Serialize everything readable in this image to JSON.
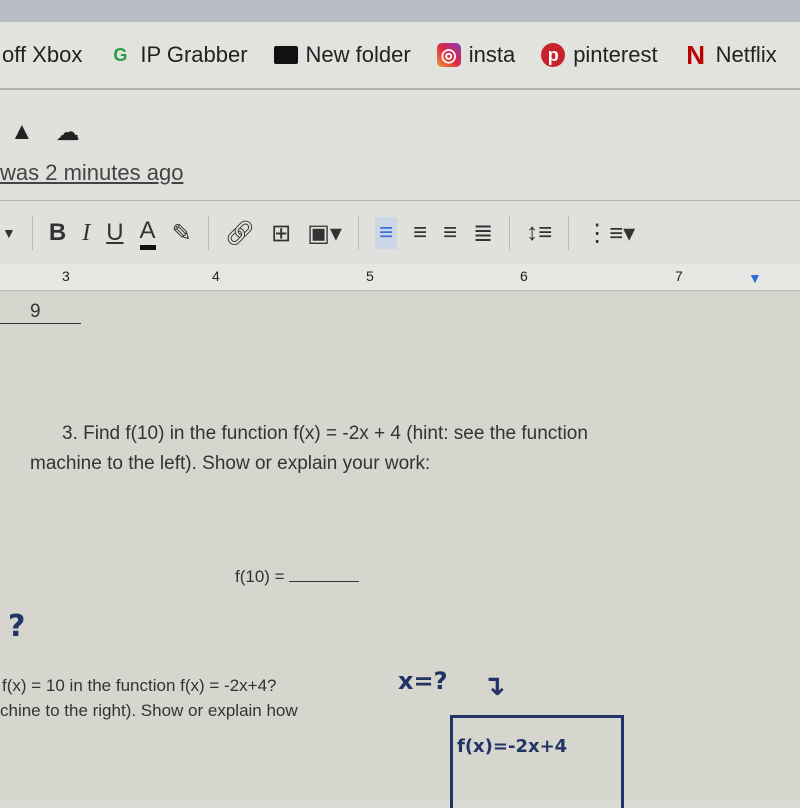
{
  "bookmarks": [
    {
      "label": "off Xbox",
      "icon": "none"
    },
    {
      "label": "IP Grabber",
      "icon": "g-logo-icon"
    },
    {
      "label": "New folder",
      "icon": "folder-icon"
    },
    {
      "label": "insta",
      "icon": "instagram-icon"
    },
    {
      "label": "pinterest",
      "icon": "pinterest-icon"
    },
    {
      "label": "Netflix",
      "icon": "netflix-icon"
    }
  ],
  "header": {
    "saved_status": "was 2 minutes ago"
  },
  "toolbar": {
    "bold": "B",
    "italic": "I",
    "underline": "U",
    "text_color": "A"
  },
  "ruler": [
    "3",
    "4",
    "5",
    "6",
    "7"
  ],
  "doc": {
    "prev_answer": "9",
    "q3_line1": "3.  Find f(10) in the function f(x) = -2x + 4 (hint: see the function",
    "q3_line2": "machine to the left). Show or explain your work:",
    "f10_label": "f(10) = ",
    "q4_heading": "?",
    "q4_line1": "f(x) = 10 in the function f(x) = -2x+4?",
    "q4_line2": "chine to the right). Show or explain how",
    "machine_input": "x=?",
    "machine_label": "f(x)=-2x+4"
  }
}
